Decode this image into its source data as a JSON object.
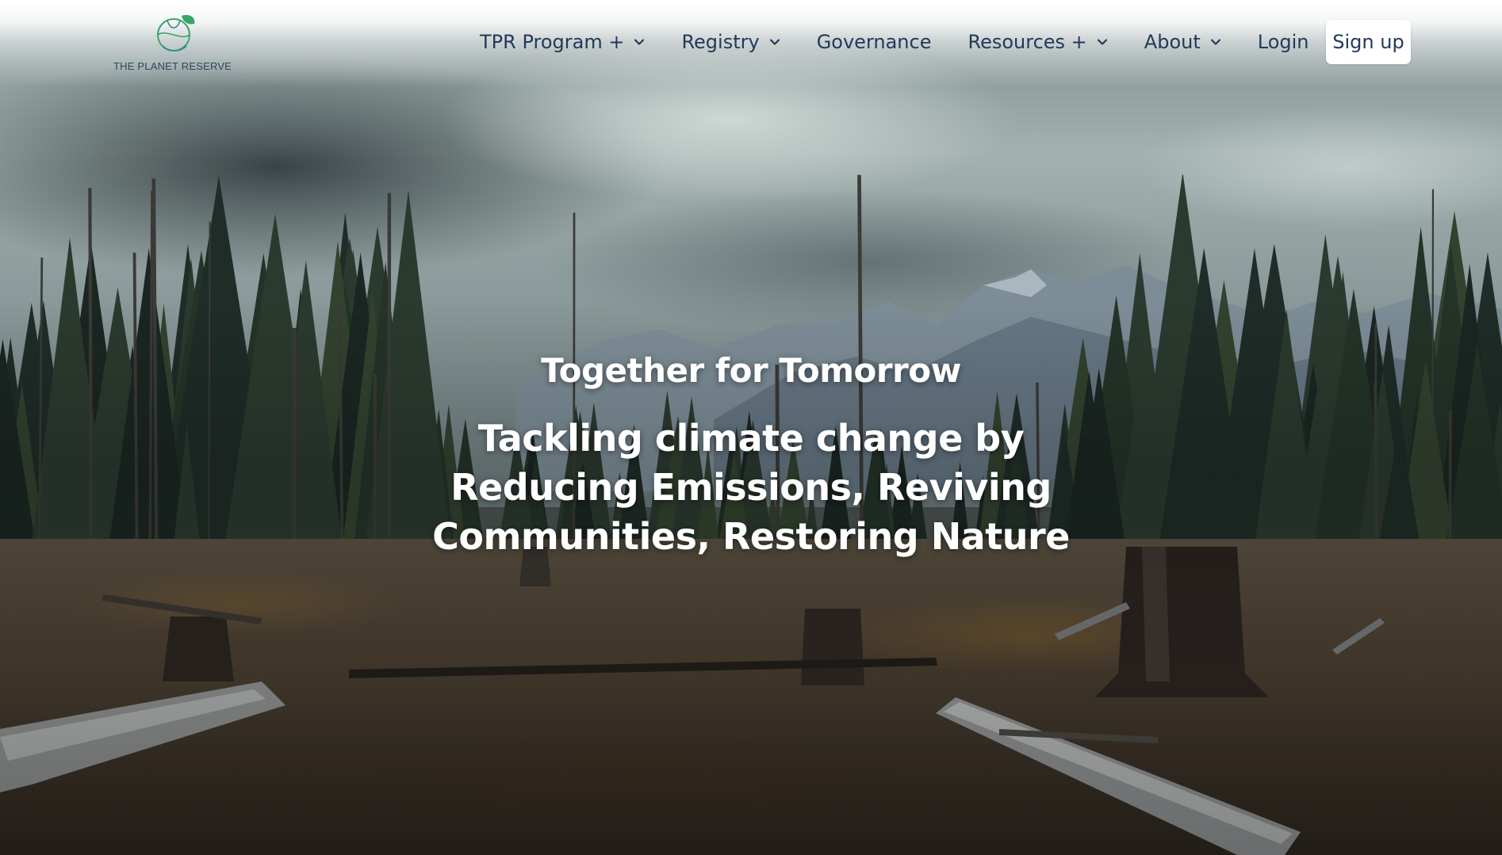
{
  "brand": {
    "name": "THE PLANET RESERVE",
    "logo_icon": "planet-leaf-icon",
    "logo_color": "#3aa36a"
  },
  "nav": {
    "items": [
      {
        "label": "TPR Program +",
        "has_dropdown": true,
        "icon": "chevron-down-icon"
      },
      {
        "label": "Registry",
        "has_dropdown": true,
        "icon": "chevron-down-icon"
      },
      {
        "label": "Governance",
        "has_dropdown": false
      },
      {
        "label": "Resources +",
        "has_dropdown": true,
        "icon": "chevron-down-icon"
      },
      {
        "label": "About",
        "has_dropdown": true,
        "icon": "chevron-down-icon"
      }
    ],
    "login_label": "Login",
    "signup_label": "Sign up",
    "text_color": "#23395b"
  },
  "hero": {
    "tagline": "Together for Tomorrow",
    "headline": "Tackling climate change by Reducing Emissions, Reviving Communities, Restoring Nature",
    "text_color": "#ffffff"
  }
}
